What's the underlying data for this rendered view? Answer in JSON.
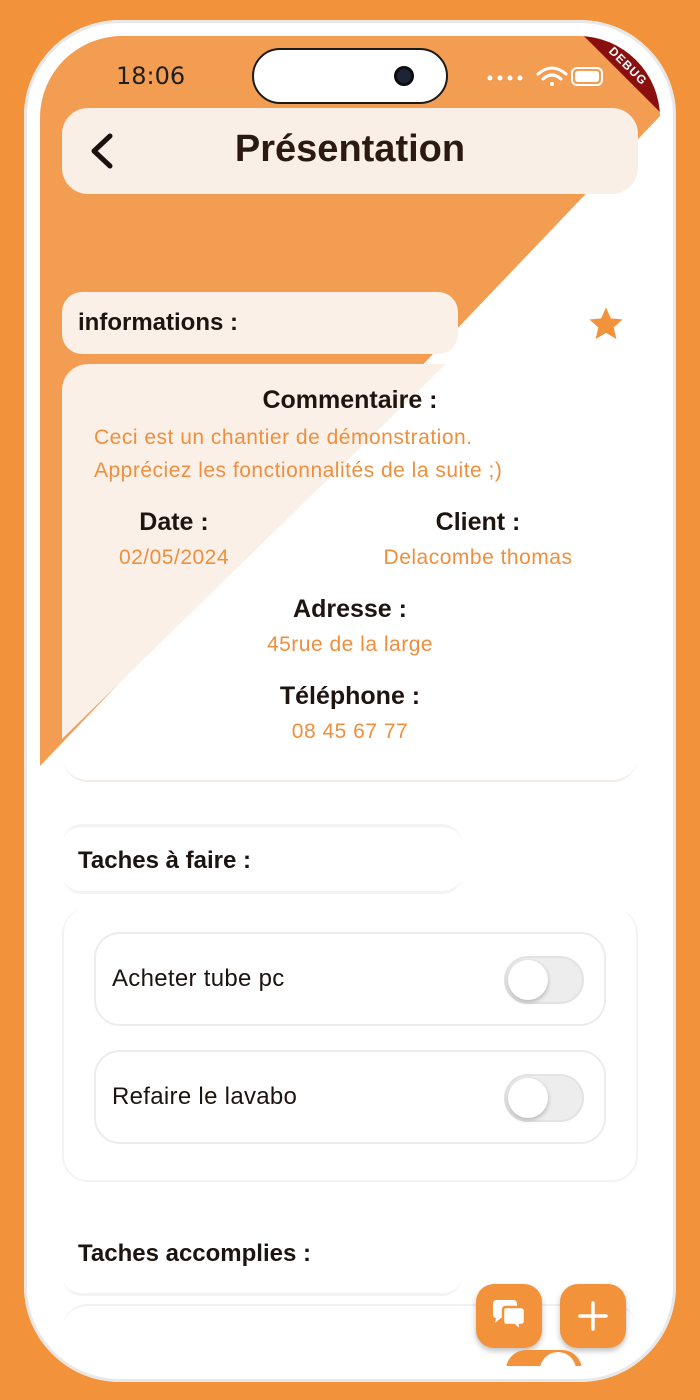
{
  "status_bar": {
    "time": "18:06",
    "debug_label": "DEBUG"
  },
  "app_bar": {
    "title": "Présentation",
    "back_icon": "chevron-left-icon"
  },
  "informations": {
    "header": "informations :",
    "favorite_icon": "star-icon",
    "commentaire_label": "Commentaire :",
    "commentaire_line1": "Ceci est un chantier de démonstration.",
    "commentaire_line2": "Appréciez les fonctionnalités de la suite ;)",
    "date_label": "Date :",
    "date_value": "02/05/2024",
    "client_label": "Client :",
    "client_value": "Delacombe thomas",
    "adresse_label": "Adresse :",
    "adresse_value": "45rue de la large",
    "telephone_label": "Téléphone :",
    "telephone_value": "08 45 67 77"
  },
  "taches_a_faire": {
    "header": "Taches à faire :",
    "items": [
      {
        "label": "Acheter tube pc",
        "done": false
      },
      {
        "label": "Refaire le lavabo",
        "done": false
      }
    ]
  },
  "taches_accomplies": {
    "header": "Taches accomplies :"
  },
  "fabs": {
    "chat_icon": "chat-bubbles-icon",
    "add_icon": "plus-icon"
  },
  "colors": {
    "accent": "#f2923a",
    "card": "#fbf0e7",
    "text_dark": "#1c1410",
    "value_text": "#ef8f3e"
  }
}
